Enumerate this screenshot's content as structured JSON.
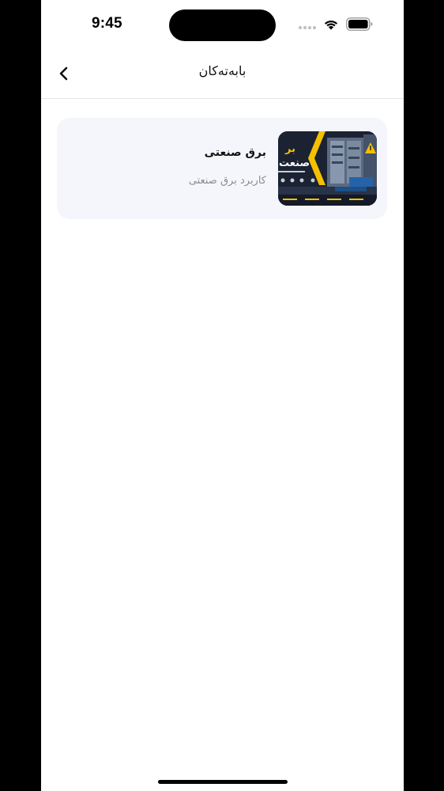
{
  "status_bar": {
    "time": "9:45"
  },
  "nav": {
    "title": "بابەتەکان",
    "back_icon": "chevron-left-icon"
  },
  "cards": [
    {
      "title": "برق صنعتی",
      "subtitle": "کاربرد برق صنعتی",
      "thumbnail_text": "برق صنعتی"
    }
  ],
  "colors": {
    "card_background": "#f5f6fb",
    "thumbnail_accent": "#f5c000",
    "thumbnail_dark": "#1b2232"
  }
}
